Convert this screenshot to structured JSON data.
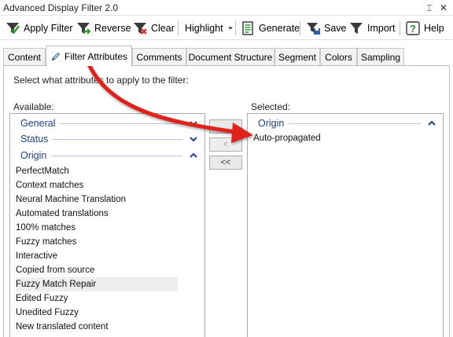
{
  "window": {
    "title": "Advanced Display Filter 2.0",
    "pin_glyph": "⌶",
    "close_glyph": "✕"
  },
  "toolbar": {
    "apply_filter": "Apply Filter",
    "reverse": "Reverse",
    "clear": "Clear",
    "highlight": "Highlight",
    "generate": "Generate",
    "save": "Save",
    "import": "Import",
    "help": "Help"
  },
  "tabs": [
    "Content",
    "Filter Attributes",
    "Comments",
    "Document Structure",
    "Segment",
    "Colors",
    "Sampling"
  ],
  "main": {
    "hint": "Select what attributes to apply to the filter:",
    "available_label": "Available:",
    "selected_label": "Selected:"
  },
  "available": {
    "groups": [
      {
        "name": "General",
        "state": "collapsed"
      },
      {
        "name": "Status",
        "state": "collapsed"
      },
      {
        "name": "Origin",
        "state": "expanded"
      }
    ],
    "items": [
      "PerfectMatch",
      "Context matches",
      "Neural Machine Translation",
      "Automated translations",
      "100% matches",
      "Fuzzy matches",
      "Interactive",
      "Copied from source",
      "Fuzzy Match Repair",
      "Edited Fuzzy",
      "Unedited Fuzzy",
      "New translated content"
    ],
    "highlighted_item": "Fuzzy Match Repair"
  },
  "selected": {
    "groups": [
      {
        "name": "Origin",
        "state": "expanded"
      }
    ],
    "items": [
      "Auto-propagated"
    ]
  },
  "buttons": {
    "remove": "<",
    "remove_all": "<<"
  },
  "colors": {
    "group_text": "#1f3f8f",
    "arrow": "#e0201c",
    "highlight_row": "#eeeeee"
  }
}
